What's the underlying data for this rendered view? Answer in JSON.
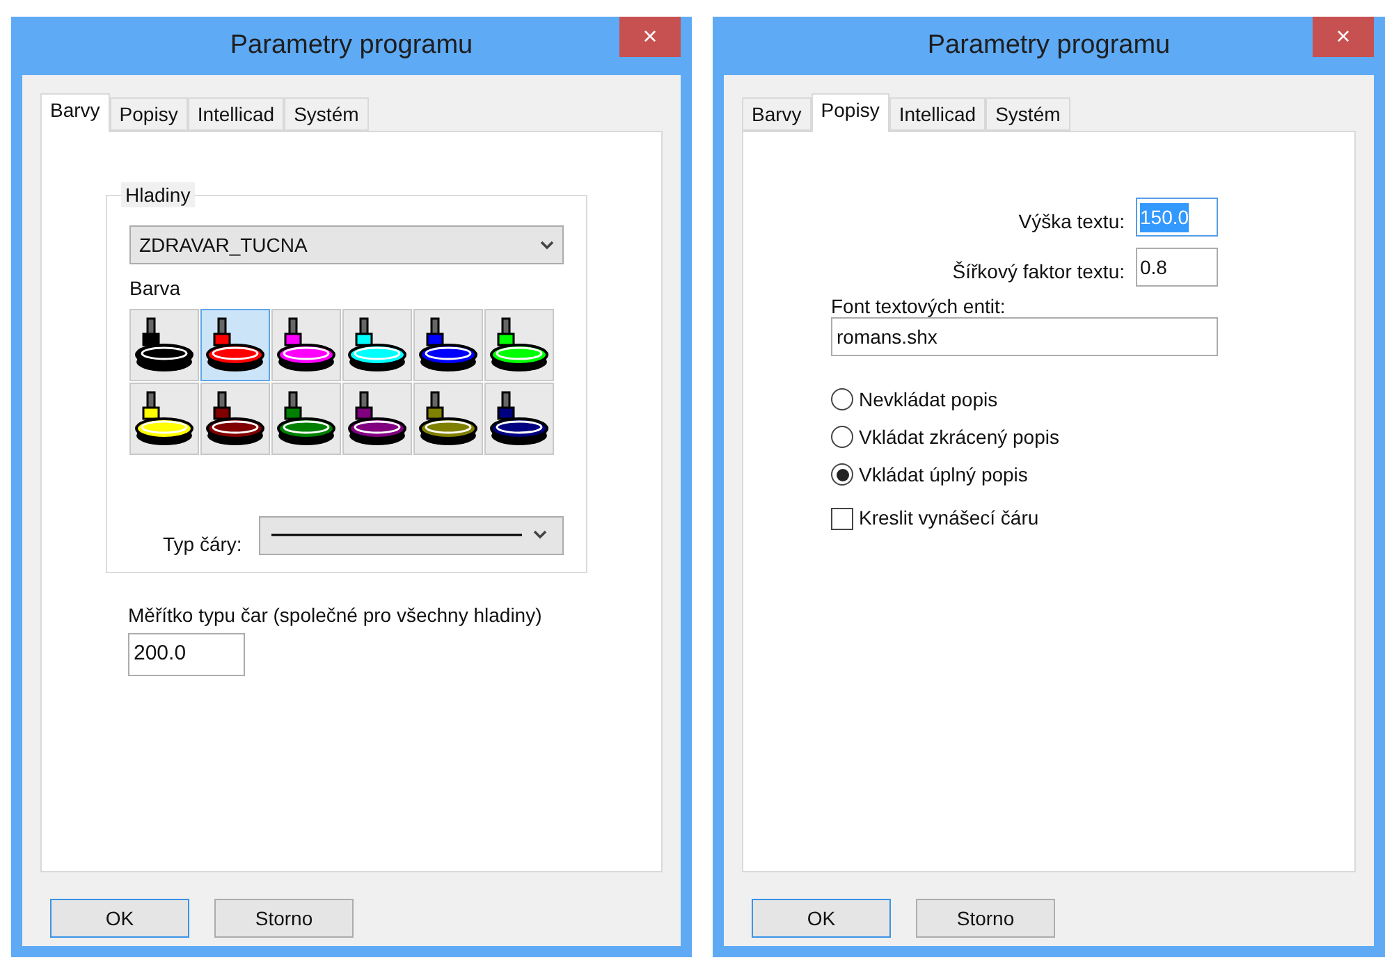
{
  "windows": [
    {
      "title": "Parametry programu",
      "close": "×",
      "kind": "colors",
      "tabs": [
        {
          "label": "Barvy",
          "selected": true
        },
        {
          "label": "Popisy",
          "selected": false
        },
        {
          "label": "Intellicad",
          "selected": false
        },
        {
          "label": "Systém",
          "selected": false
        }
      ],
      "panel": {
        "group_title": "Hladiny",
        "layer": "ZDRAVAR_TUCNA",
        "color_label": "Barva",
        "swatches": [
          {
            "color": "#000000",
            "selected": false
          },
          {
            "color": "#ff0000",
            "selected": true
          },
          {
            "color": "#ff00ff",
            "selected": false
          },
          {
            "color": "#00ffff",
            "selected": false
          },
          {
            "color": "#0000ff",
            "selected": false
          },
          {
            "color": "#00ff00",
            "selected": false
          },
          {
            "color": "#ffff00",
            "selected": false
          },
          {
            "color": "#800000",
            "selected": false
          },
          {
            "color": "#008000",
            "selected": false
          },
          {
            "color": "#800080",
            "selected": false
          },
          {
            "color": "#808000",
            "selected": false
          },
          {
            "color": "#000080",
            "selected": false
          }
        ],
        "line_type_label": "Typ čáry:",
        "scale_label": "Měřítko typu čar (společné pro všechny hladiny)",
        "scale_value": "200.0"
      },
      "buttons": [
        {
          "label": "OK",
          "default": true
        },
        {
          "label": "Storno",
          "default": false
        }
      ]
    },
    {
      "title": "Parametry programu",
      "close": "×",
      "kind": "labels",
      "tabs": [
        {
          "label": "Barvy",
          "selected": false
        },
        {
          "label": "Popisy",
          "selected": true
        },
        {
          "label": "Intellicad",
          "selected": false
        },
        {
          "label": "Systém",
          "selected": false
        }
      ],
      "panel": {
        "fields": [
          {
            "label": "Výška textu:",
            "value": "150.0",
            "highlighted": true
          },
          {
            "label": "Šířkový faktor textu:",
            "value": "0.8",
            "highlighted": false
          }
        ],
        "font_label": "Font textových entit:",
        "font_value": "romans.shx",
        "radios": [
          {
            "label": "Nevkládat popis",
            "selected": false
          },
          {
            "label": "Vkládat zkrácený popis",
            "selected": false
          },
          {
            "label": "Vkládat úplný popis",
            "selected": true
          }
        ],
        "checkbox": {
          "label": "Kreslit vynášecí čáru",
          "checked": false
        }
      },
      "buttons": [
        {
          "label": "OK",
          "default": true
        },
        {
          "label": "Storno",
          "default": false
        }
      ]
    }
  ]
}
